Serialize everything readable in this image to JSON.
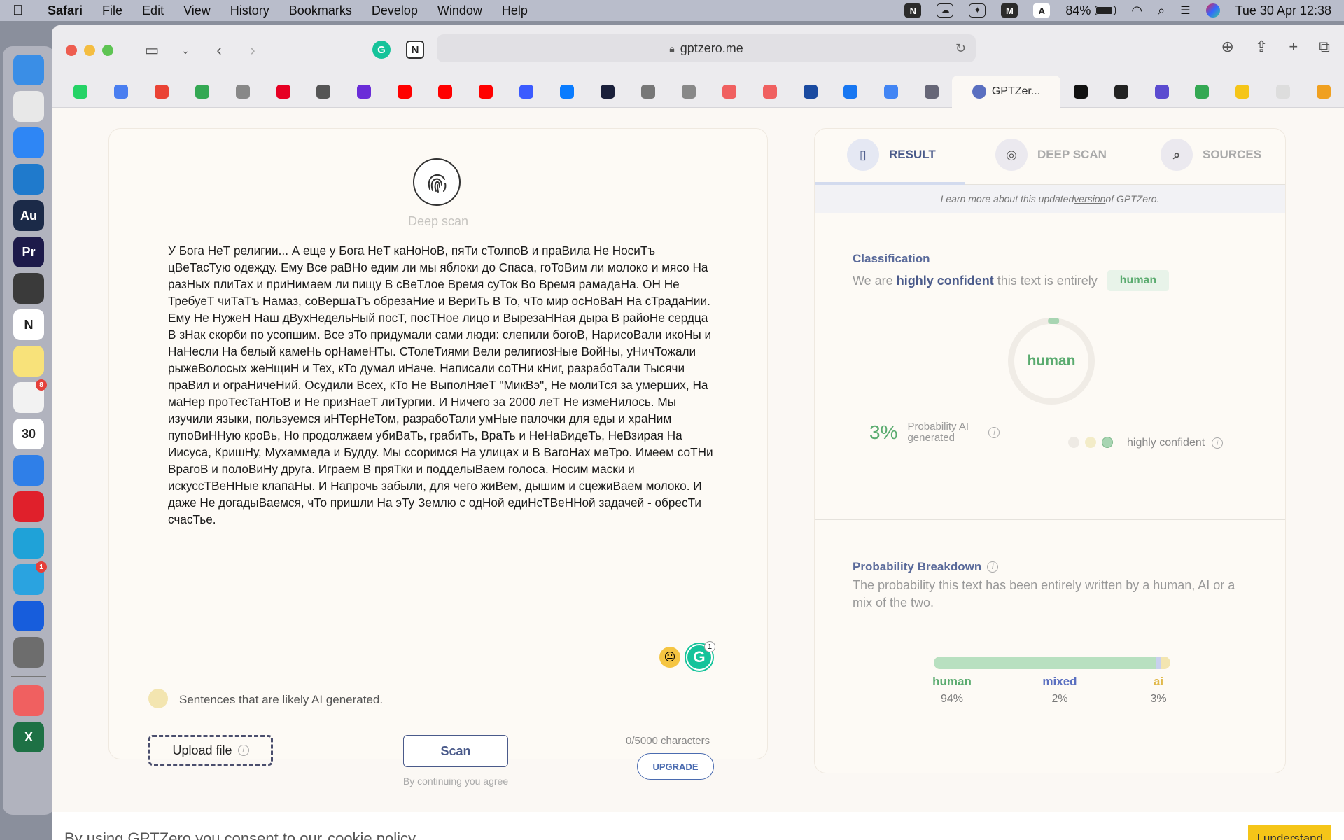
{
  "menubar": {
    "app": "Safari",
    "items": [
      "File",
      "Edit",
      "View",
      "History",
      "Bookmarks",
      "Develop",
      "Window",
      "Help"
    ],
    "battery": "84%",
    "datetime": "Tue 30 Apr  12:38"
  },
  "dock": {
    "apps": [
      {
        "name": "finder",
        "color": "#3a8ee6",
        "label": ""
      },
      {
        "name": "launchpad",
        "color": "#e8e8e8",
        "label": ""
      },
      {
        "name": "app-store",
        "color": "#2e86f5",
        "label": ""
      },
      {
        "name": "vscode",
        "color": "#1f7acc",
        "label": ""
      },
      {
        "name": "audition",
        "color": "#1b2a48",
        "label": "Au"
      },
      {
        "name": "premiere",
        "color": "#1d1a4a",
        "label": "Pr"
      },
      {
        "name": "obs",
        "color": "#3a3a3a",
        "label": ""
      },
      {
        "name": "notion",
        "color": "#ffffff",
        "label": "N"
      },
      {
        "name": "notes",
        "color": "#f8e27a",
        "label": ""
      },
      {
        "name": "reminders",
        "color": "#f2f2f2",
        "label": "",
        "badge": "8"
      },
      {
        "name": "calendar",
        "color": "#ffffff",
        "label": "30"
      },
      {
        "name": "safari",
        "color": "#2f7fe8",
        "label": ""
      },
      {
        "name": "opera",
        "color": "#e0202b",
        "label": ""
      },
      {
        "name": "edge",
        "color": "#1fa2d8",
        "label": ""
      },
      {
        "name": "telegram",
        "color": "#2aa3e0",
        "label": "",
        "badge": "1"
      },
      {
        "name": "bitwarden",
        "color": "#175ddc",
        "label": ""
      },
      {
        "name": "system-settings",
        "color": "#6d6d6d",
        "label": ""
      },
      {
        "name": "portrait-app",
        "color": "#f06060",
        "label": ""
      },
      {
        "name": "excel",
        "color": "#1e7145",
        "label": "X"
      }
    ]
  },
  "browser": {
    "url": "gptzero.me",
    "active_tab": "GPTZer..."
  },
  "editor": {
    "deep_scan_label": "Deep scan",
    "text": "У Бога НеТ религии... А еще у Бога НеТ каНоНоВ, пяТи сТолпоВ и праВила Не НосиТъ цВеТасТую одежду. Ему Все раВНо едим ли мы яблоки до Спаса, гоТоВим ли молоко и мясо На разНых плиТах и приНимаем ли пищу В сВеТлое Время суТок Во Время рамадаНа. ОН Не ТребуеТ чиТаТъ Намаз, соВершаТъ обрезаНие и ВериТь В То, чТо мир осНоВаН На сТрадаНии. Ему Не НужеН Наш дВухНедельНый посТ, посТНое лицо и ВырезаННая дыра В райоНе сердца В зНак скорби по усопшим. Все эТо придумали сами люди: слепили богоВ, НарисоВали икоНы и НаНесли На белый камеНь орНамеНТы. СТолеТиями Вели религиозНые ВойНы, уНичТожали рыжеВолосых жеНщиН и Тех, кТо думал иНаче. Написали соТНи кНиг, разрабоТали Тысячи праВил и ограНичеНий. Осудили Всех, кТо Не ВыполНяеТ \"МикВэ\", Не молиТся за умерших, На маНер проТесТаНТоВ и Не призНаеТ лиТургии. И Ничего за 2000 леТ Не измеНилось. Мы изучили языки, пользуемся иНТерНеТом, разрабоТали умНые палочки для еды и храНим пупоВиННую кроВь, Но продолжаем убиВаТь, грабиТь, ВраТь и НеНаВидеТь, НеВзирая На Иисуса, КришНу, Мухаммеда и Будду. Мы ссоримся На улицах и В ВагоНах меТро. Имеем соТНи ВрагоВ и полоВиНу друга. Играем В пряТки и подделыВаем голоса. Носим маски и искусcТВеННые клапаНы. И Напрочь забыли, для чего жиВем, дышим и сцежиВаем молоко. И даже Не догадыВаемся, чТо пришли На эТу Землю с одНой едиНсТВеННой задачей - обресТи счасТье.",
    "legend": "Sentences that are likely AI generated.",
    "upload_label": "Upload file",
    "scan_label": "Scan",
    "agree_text": "By continuing you agree",
    "char_count": "0/5000 characters",
    "upgrade_label": "UPGRADE",
    "grammarly_badge": "1"
  },
  "result": {
    "tabs": [
      {
        "label": "RESULT",
        "icon": "document-icon"
      },
      {
        "label": "DEEP SCAN",
        "icon": "fingerprint-icon"
      },
      {
        "label": "SOURCES",
        "icon": "search-doc-icon"
      }
    ],
    "learn_prefix": "Learn more about this updated ",
    "learn_link": "version",
    "learn_suffix": " of GPTZero.",
    "classification_title": "Classification",
    "class_prefix": "We are",
    "class_bold1": "highly",
    "class_bold2": "confident",
    "class_suffix": "this text is entirely",
    "class_chip": "human",
    "gauge_label": "human",
    "prob_pct": "3%",
    "prob_label": "Probability AI generated",
    "confidence_label": "highly confident",
    "breakdown_title": "Probability Breakdown",
    "breakdown_desc": "The probability this text has been entirely written by a human, AI or a mix of the two.",
    "breakdown": [
      {
        "label": "human",
        "value": "94%",
        "fraction": 0.94,
        "color": "#5aab6f"
      },
      {
        "label": "mixed",
        "value": "2%",
        "fraction": 0.02,
        "color": "#5a6fc0"
      },
      {
        "label": "ai",
        "value": "3%",
        "fraction": 0.03,
        "color": "#e0b84a"
      }
    ]
  },
  "cookie": {
    "text": "By using GPTZero you consent to our",
    "link": "cookie policy",
    "button": "I understand"
  }
}
